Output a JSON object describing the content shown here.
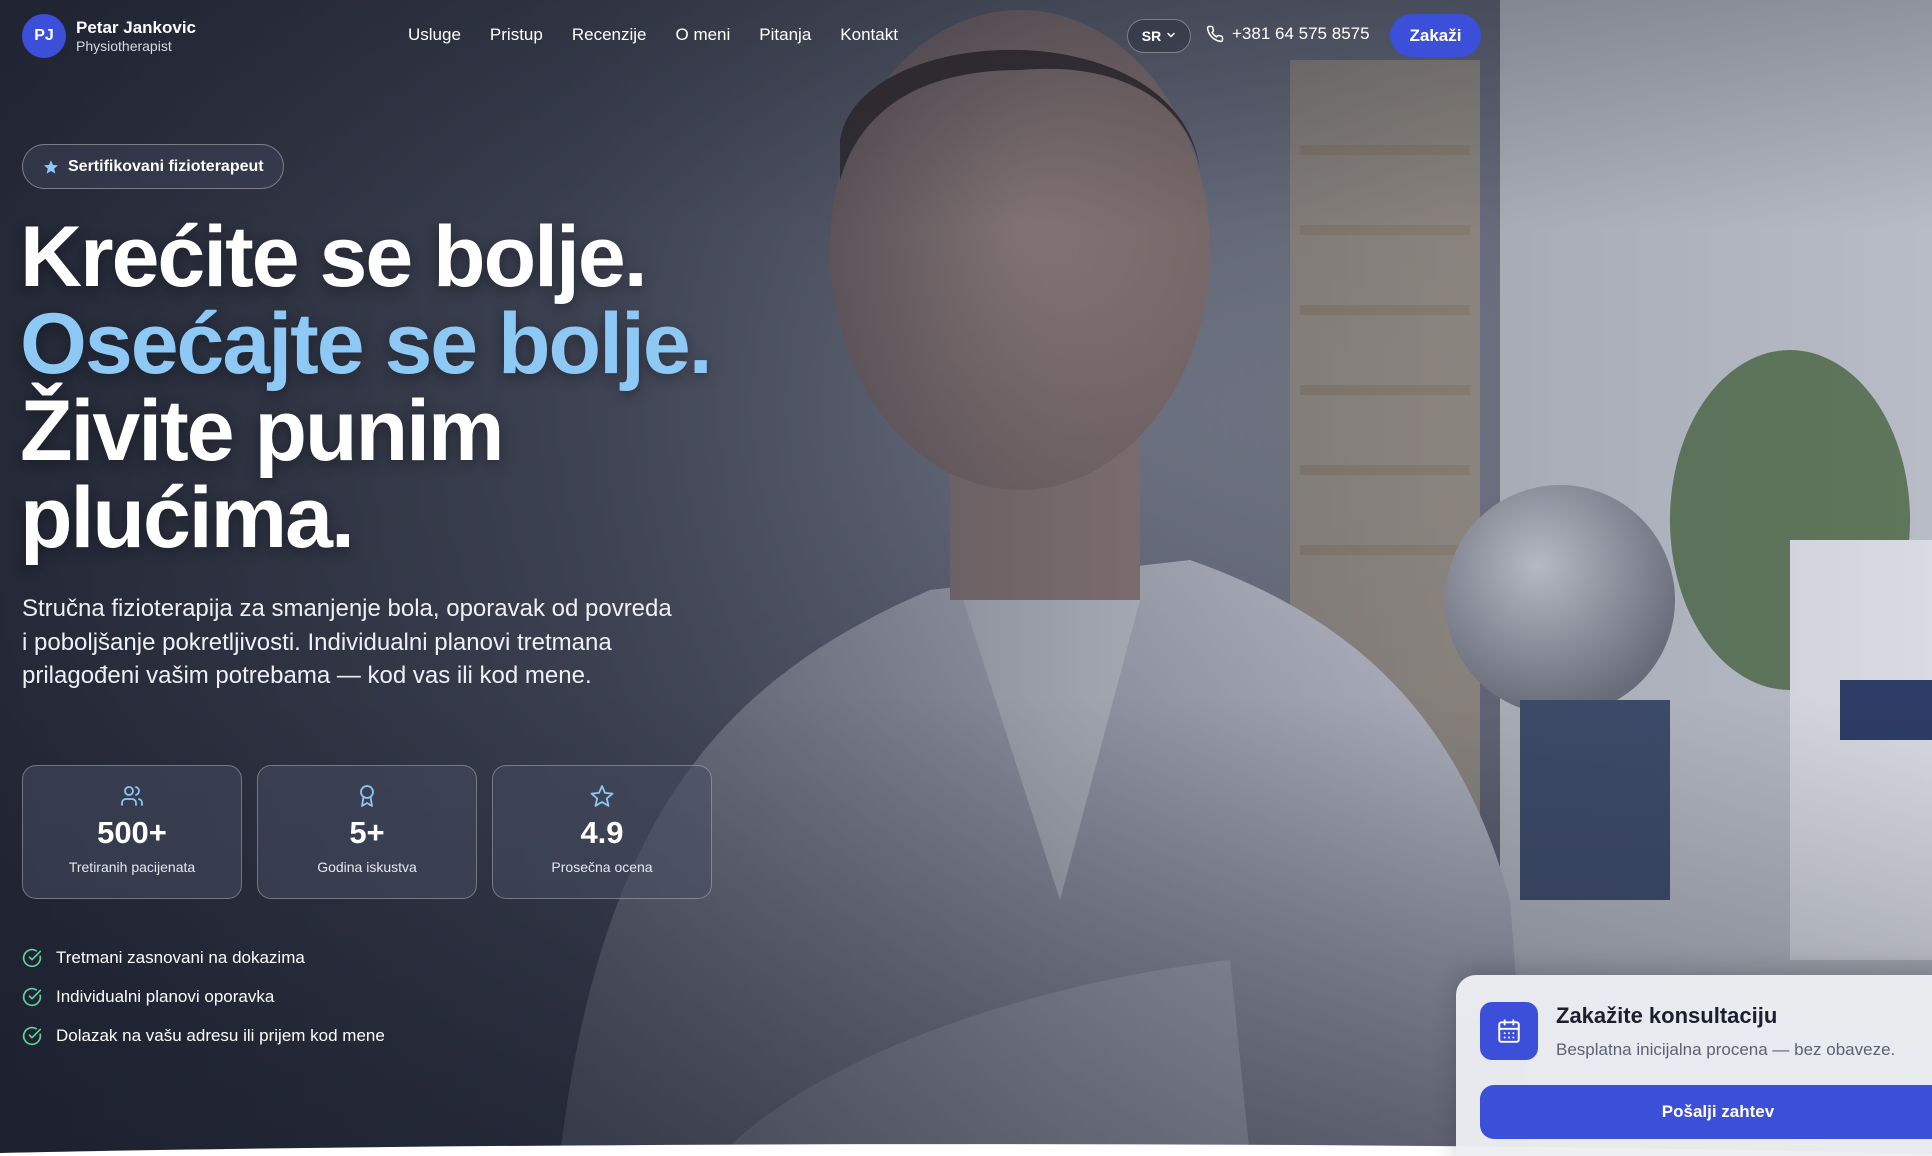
{
  "brand": {
    "initials": "PJ",
    "name": "Petar Jankovic",
    "subtitle": "Physiotherapist"
  },
  "nav": [
    "Usluge",
    "Pristup",
    "Recenzije",
    "O meni",
    "Pitanja",
    "Kontakt"
  ],
  "header": {
    "language": "SR",
    "phone": "+381 64 575 8575",
    "cta": "Zakaži"
  },
  "hero": {
    "badge": "Sertifikovani fizioterapeut",
    "headline": [
      "Krećite se bolje.",
      "Osećajte se bolje.",
      "Živite punim",
      "plućima."
    ],
    "lead": "Stručna fizioterapija za smanjenje bola, oporavak od povreda i poboljšanje pokretljivosti. Individualni planovi tretmana prilagođeni vašim potrebama — kod vas ili kod mene."
  },
  "stats": [
    {
      "icon": "users-icon",
      "value": "500+",
      "label": "Tretiranih pacijenata"
    },
    {
      "icon": "award-icon",
      "value": "5+",
      "label": "Godina iskustva"
    },
    {
      "icon": "star-icon",
      "value": "4.9",
      "label": "Prosečna ocena"
    }
  ],
  "checks": [
    "Tretmani zasnovani na dokazima",
    "Individualni planovi oporavka",
    "Dolazak na vašu adresu ili prijem kod mene"
  ],
  "card": {
    "title": "Zakažite konsultaciju",
    "subtitle": "Besplatna inicijalna procena — bez obaveze.",
    "button": "Pošalji zahtev"
  },
  "colors": {
    "primary": "#3b4fd8",
    "accent": "#8ec8f5",
    "check": "#5fd3a0"
  }
}
